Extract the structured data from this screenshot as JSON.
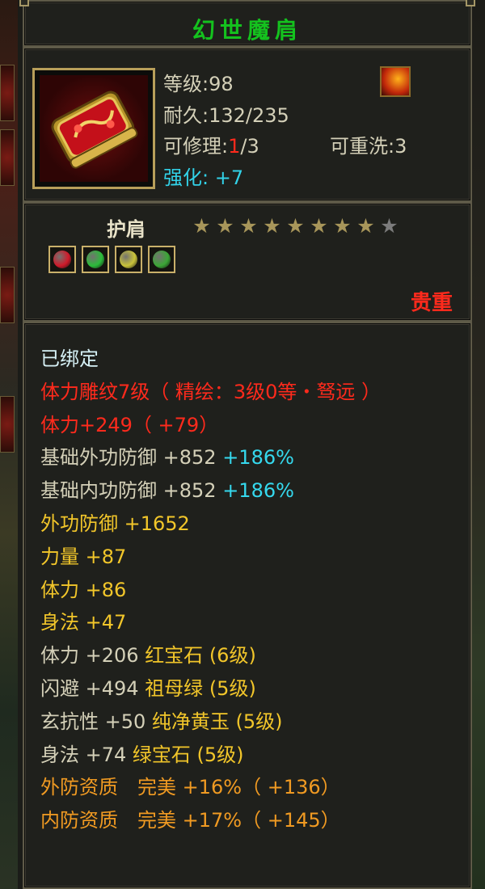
{
  "item": {
    "name": "幻世魔肩",
    "level_label": "等级",
    "level_sep": ":",
    "level_value": "98",
    "durability_label": "耐久",
    "durability_sep": ":",
    "durability_value": "132/235",
    "repair_label": "可修理",
    "repair_sep": ":",
    "repair_current": "1",
    "repair_max": "/3",
    "rewash_label": "可重洗",
    "rewash_sep": ":",
    "rewash_value": "3",
    "enhance_label": "强化:",
    "enhance_value": "+7",
    "type": "护肩",
    "rarity": "贵重",
    "icon": "golden-red-shoulder-pad",
    "badge_icon": "flame-badge"
  },
  "stars": {
    "filled": 8,
    "total": 9,
    "filled_color": "#a8965a",
    "empty_color": "#7c7c7c"
  },
  "gem_slots": [
    {
      "icon": "red-gem",
      "color": "#d01a2a"
    },
    {
      "icon": "green-gem",
      "color": "#2bbb3a"
    },
    {
      "icon": "yellow-gem",
      "color": "#c9c33a"
    },
    {
      "icon": "jade-gem",
      "color": "#3ba636"
    }
  ],
  "attributes": [
    {
      "text": "已绑定",
      "color": "#d7f2f7"
    },
    {
      "text": "体力雕纹7级（ 精绘：3级0等・驽远 ）",
      "color": "#ff2a1c"
    },
    {
      "text": "体力+249（ +79）",
      "color": "#ff2a1c"
    },
    {
      "text": "基础外功防御 +852 ",
      "color": "#d4d0b8",
      "extra": "+186%",
      "extra_color": "#35d9ee"
    },
    {
      "text": "基础内功防御 +852 ",
      "color": "#d4d0b8",
      "extra": "+186%",
      "extra_color": "#35d9ee"
    },
    {
      "text": "外功防御 +1652",
      "color": "#f2c62a"
    },
    {
      "text": "力量 +87",
      "color": "#f2c62a"
    },
    {
      "text": "体力 +86",
      "color": "#f2c62a"
    },
    {
      "text": "身法 +47",
      "color": "#f2c62a"
    },
    {
      "text": "体力 +206 ",
      "color": "#d4d0b8",
      "extra": "红宝石 (6级)",
      "extra_color": "#f2c62a"
    },
    {
      "text": "闪避 +494 ",
      "color": "#d4d0b8",
      "extra": "祖母绿 (5级)",
      "extra_color": "#f2c62a"
    },
    {
      "text": "玄抗性 +50 ",
      "color": "#d4d0b8",
      "extra": "纯净黄玉 (5级)",
      "extra_color": "#f2c62a"
    },
    {
      "text": "身法 +74 ",
      "color": "#d4d0b8",
      "extra": "绿宝石 (5级)",
      "extra_color": "#f2c62a"
    },
    {
      "text": "外防资质　完美 +16%（ +136）",
      "color": "#f09a22"
    },
    {
      "text": "内防资质　完美 +17%（ +145）",
      "color": "#f09a22"
    }
  ]
}
